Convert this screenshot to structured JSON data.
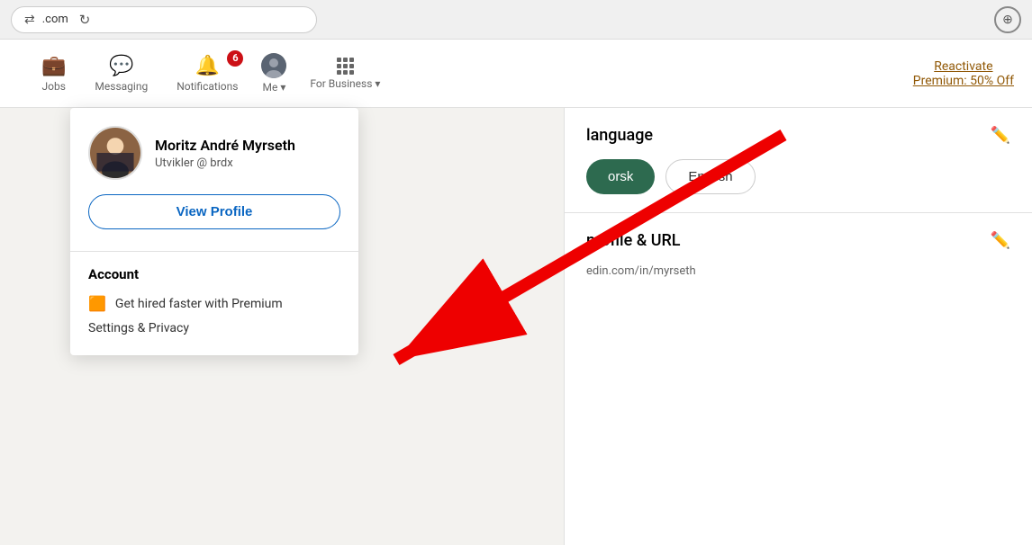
{
  "browser": {
    "address": ".com",
    "reload_label": "↻",
    "download_label": "⬇"
  },
  "nav": {
    "jobs_label": "Jobs",
    "messaging_label": "Messaging",
    "notifications_label": "Notifications",
    "notifications_count": "6",
    "me_label": "Me",
    "for_business_label": "For Business",
    "reactivate_line1": "Reactivate",
    "reactivate_line2": "Premium: 50% Off"
  },
  "dropdown": {
    "profile_name": "Moritz André Myrseth",
    "profile_title": "Utvikler @ brdx",
    "view_profile_label": "View Profile",
    "account_title": "Account",
    "premium_label": "Get hired faster with Premium",
    "settings_label": "Settings & Privacy"
  },
  "right_panel": {
    "language_title": "language",
    "language_active": "orsk",
    "language_english": "English",
    "profile_url_title": "profile & URL",
    "profile_url_value": "edin.com/in/myrseth"
  }
}
